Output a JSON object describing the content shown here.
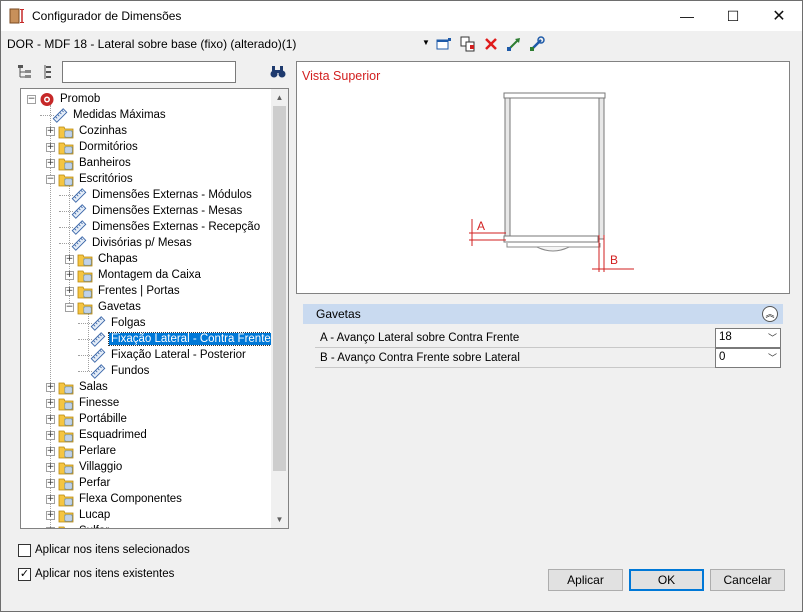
{
  "window": {
    "title": "Configurador de Dimensões",
    "minimize_glyph": "—",
    "maximize_glyph": "☐",
    "close_glyph": "✕"
  },
  "toolbar": {
    "item_title": "DOR - MDF 18 - Lateral sobre base (fixo) (alterado)(1)",
    "icons": [
      "dropdown-icon",
      "properties-icon",
      "copy-icon",
      "delete-icon",
      "move-icon",
      "tools-icon"
    ]
  },
  "search": {
    "value": "",
    "icons": [
      "expand-all-icon",
      "collapse-all-icon",
      "find-icon"
    ]
  },
  "tree": {
    "items": [
      {
        "label": "Promob",
        "level": 0,
        "expander": "minus",
        "icon": "promob-logo-icon"
      },
      {
        "label": "Medidas Máximas",
        "level": 1,
        "expander": "none",
        "icon": "ruler-icon"
      },
      {
        "label": "Cozinhas",
        "level": 1,
        "expander": "plus",
        "icon": "folder-icon"
      },
      {
        "label": "Dormitórios",
        "level": 1,
        "expander": "plus",
        "icon": "folder-icon"
      },
      {
        "label": "Banheiros",
        "level": 1,
        "expander": "plus",
        "icon": "folder-icon"
      },
      {
        "label": "Escritórios",
        "level": 1,
        "expander": "minus",
        "icon": "folder-icon"
      },
      {
        "label": "Dimensões Externas - Módulos",
        "level": 2,
        "expander": "none",
        "icon": "ruler-icon"
      },
      {
        "label": "Dimensões Externas - Mesas",
        "level": 2,
        "expander": "none",
        "icon": "ruler-icon"
      },
      {
        "label": "Dimensões Externas - Recepção",
        "level": 2,
        "expander": "none",
        "icon": "ruler-icon"
      },
      {
        "label": "Divisórias p/ Mesas",
        "level": 2,
        "expander": "none",
        "icon": "ruler-icon"
      },
      {
        "label": "Chapas",
        "level": 2,
        "expander": "plus",
        "icon": "folder-icon"
      },
      {
        "label": "Montagem da Caixa",
        "level": 2,
        "expander": "plus",
        "icon": "folder-icon"
      },
      {
        "label": "Frentes | Portas",
        "level": 2,
        "expander": "plus",
        "icon": "folder-icon"
      },
      {
        "label": "Gavetas",
        "level": 2,
        "expander": "minus",
        "icon": "folder-icon"
      },
      {
        "label": "Folgas",
        "level": 3,
        "expander": "none",
        "icon": "ruler-icon"
      },
      {
        "label": "Fixação Lateral - Contra Frente",
        "level": 3,
        "expander": "none",
        "icon": "ruler-icon",
        "selected": true
      },
      {
        "label": "Fixação Lateral - Posterior",
        "level": 3,
        "expander": "none",
        "icon": "ruler-icon"
      },
      {
        "label": "Fundos",
        "level": 3,
        "expander": "none",
        "icon": "ruler-icon"
      },
      {
        "label": "Salas",
        "level": 1,
        "expander": "plus",
        "icon": "folder-icon"
      },
      {
        "label": "Finesse",
        "level": 1,
        "expander": "plus",
        "icon": "folder-icon"
      },
      {
        "label": "Portábille",
        "level": 1,
        "expander": "plus",
        "icon": "folder-icon"
      },
      {
        "label": "Esquadrimed",
        "level": 1,
        "expander": "plus",
        "icon": "folder-icon"
      },
      {
        "label": "Perlare",
        "level": 1,
        "expander": "plus",
        "icon": "folder-icon"
      },
      {
        "label": "Villaggio",
        "level": 1,
        "expander": "plus",
        "icon": "folder-icon"
      },
      {
        "label": "Perfar",
        "level": 1,
        "expander": "plus",
        "icon": "folder-icon"
      },
      {
        "label": "Flexa Componentes",
        "level": 1,
        "expander": "plus",
        "icon": "folder-icon"
      },
      {
        "label": "Lucap",
        "level": 1,
        "expander": "plus",
        "icon": "folder-icon"
      },
      {
        "label": "Sulfar",
        "level": 1,
        "expander": "plus",
        "icon": "folder-icon"
      }
    ]
  },
  "preview": {
    "title": "Vista Superior",
    "label_a": "A",
    "label_b": "B",
    "accent_color": "#d21f1f"
  },
  "properties": {
    "group_title": "Gavetas",
    "rows": [
      {
        "label": "A - Avanço Lateral sobre Contra Frente",
        "value": "18"
      },
      {
        "label": "B - Avanço Contra Frente sobre Lateral",
        "value": "0"
      }
    ]
  },
  "options": {
    "apply_selected": {
      "label": "Aplicar nos itens selecionados",
      "checked": false
    },
    "apply_existing": {
      "label": "Aplicar nos itens existentes",
      "checked": true
    }
  },
  "buttons": {
    "apply": "Aplicar",
    "ok": "OK",
    "cancel": "Cancelar"
  }
}
